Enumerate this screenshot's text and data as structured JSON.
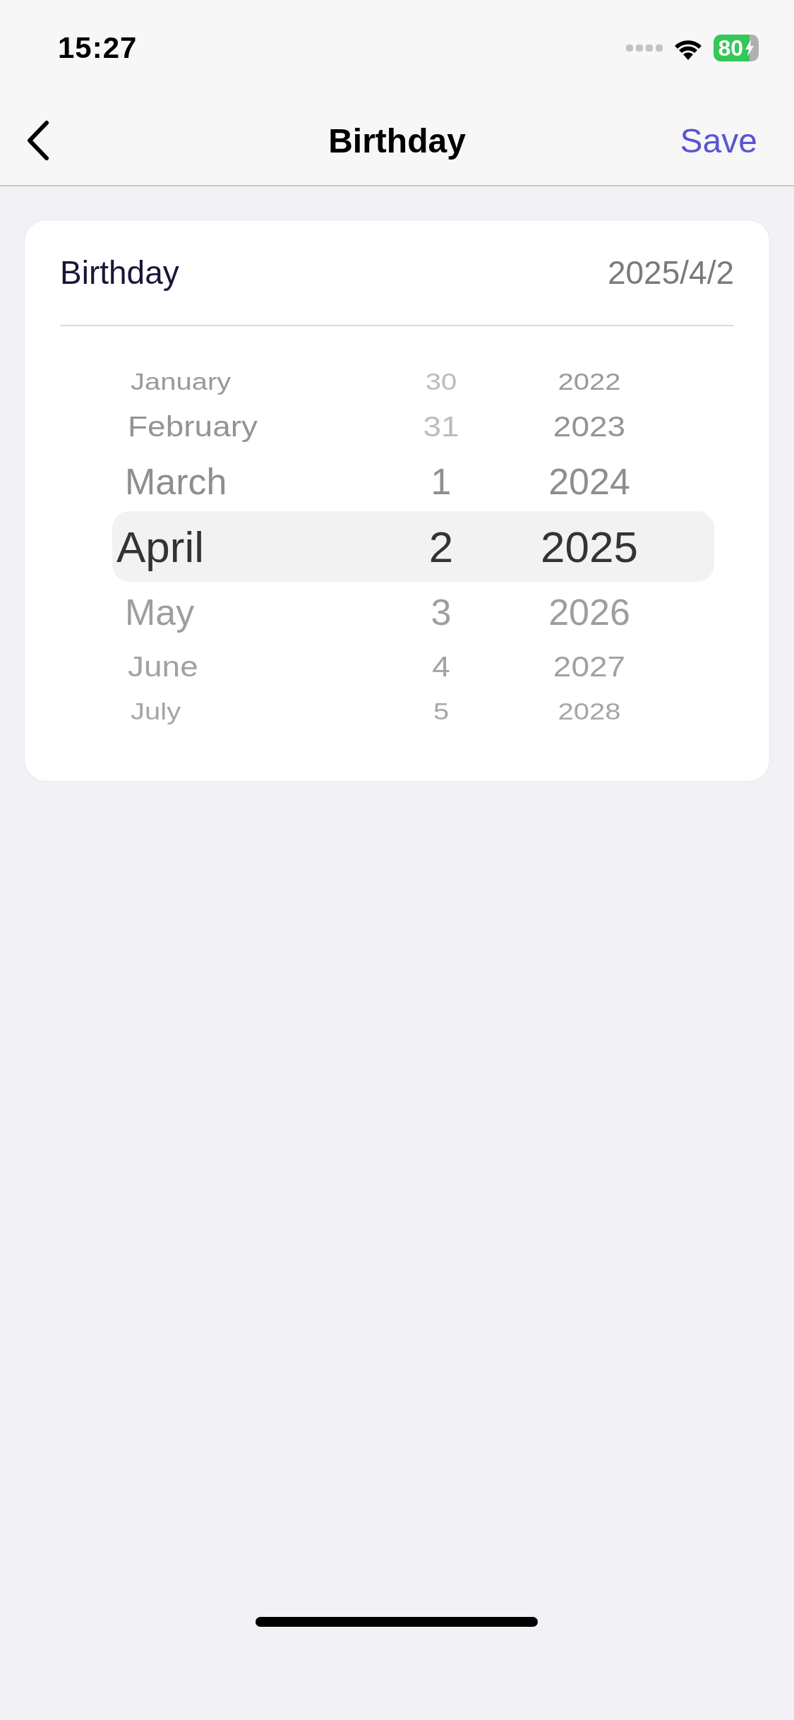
{
  "status_bar": {
    "time": "15:27",
    "battery": "80"
  },
  "nav": {
    "title": "Birthday",
    "action": "Save"
  },
  "field": {
    "label": "Birthday",
    "value": "2025/4/2"
  },
  "picker": {
    "rows": [
      {
        "month": "January",
        "day": "30",
        "year": "2022",
        "selected": false,
        "day_valid": false
      },
      {
        "month": "February",
        "day": "31",
        "year": "2023",
        "selected": false,
        "day_valid": false
      },
      {
        "month": "March",
        "day": "1",
        "year": "2024",
        "selected": false,
        "day_valid": true
      },
      {
        "month": "April",
        "day": "2",
        "year": "2025",
        "selected": true,
        "day_valid": true
      },
      {
        "month": "May",
        "day": "3",
        "year": "2026",
        "selected": false,
        "day_valid": true
      },
      {
        "month": "June",
        "day": "4",
        "year": "2027",
        "selected": false,
        "day_valid": true
      },
      {
        "month": "July",
        "day": "5",
        "year": "2028",
        "selected": false,
        "day_valid": true
      }
    ]
  }
}
